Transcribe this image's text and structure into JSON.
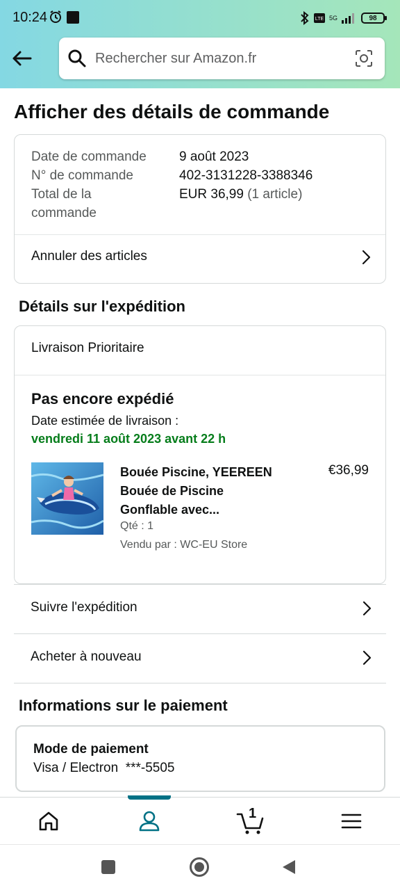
{
  "status_bar": {
    "time": "10:24",
    "battery": "98",
    "network": "5G"
  },
  "search": {
    "placeholder": "Rechercher sur Amazon.fr"
  },
  "page": {
    "title": "Afficher des détails de commande"
  },
  "order": {
    "date_label": "Date de commande",
    "date_value": "9 août 2023",
    "number_label": "N° de commande",
    "number_value": "402-3131228-3388346",
    "total_label_line1": "Total de la",
    "total_label_line2": "commande",
    "total_value": "EUR 36,99",
    "total_items": "(1 article)",
    "cancel_label": "Annuler des articles"
  },
  "shipping": {
    "section_title": "Détails sur l'expédition",
    "method": "Livraison Prioritaire",
    "status": "Pas encore expédié",
    "estimated_label": "Date estimée de livraison :",
    "estimated_date": "vendredi 11 août 2023 avant 22 h",
    "product": {
      "title_line1": "Bouée Piscine, YEEREEN",
      "title_line2": "Bouée de Piscine",
      "title_line3": "Gonflable avec...",
      "price": "€36,99",
      "qty": "Qté : 1",
      "seller": "Vendu par : WC-EU Store"
    },
    "track_label": "Suivre l'expédition",
    "buy_again_label": "Acheter à nouveau"
  },
  "payment": {
    "section_title": "Informations sur le paiement",
    "method_title": "Mode de paiement",
    "method_value": "Visa / Electron  ***-5505"
  },
  "bottom_nav": {
    "cart_count": "1",
    "active": "account",
    "accent_color": "#007185"
  },
  "colors": {
    "delivery_green": "#067d1b",
    "header_gradient_start": "#84d8e3",
    "header_gradient_end": "#a5e6ba"
  }
}
